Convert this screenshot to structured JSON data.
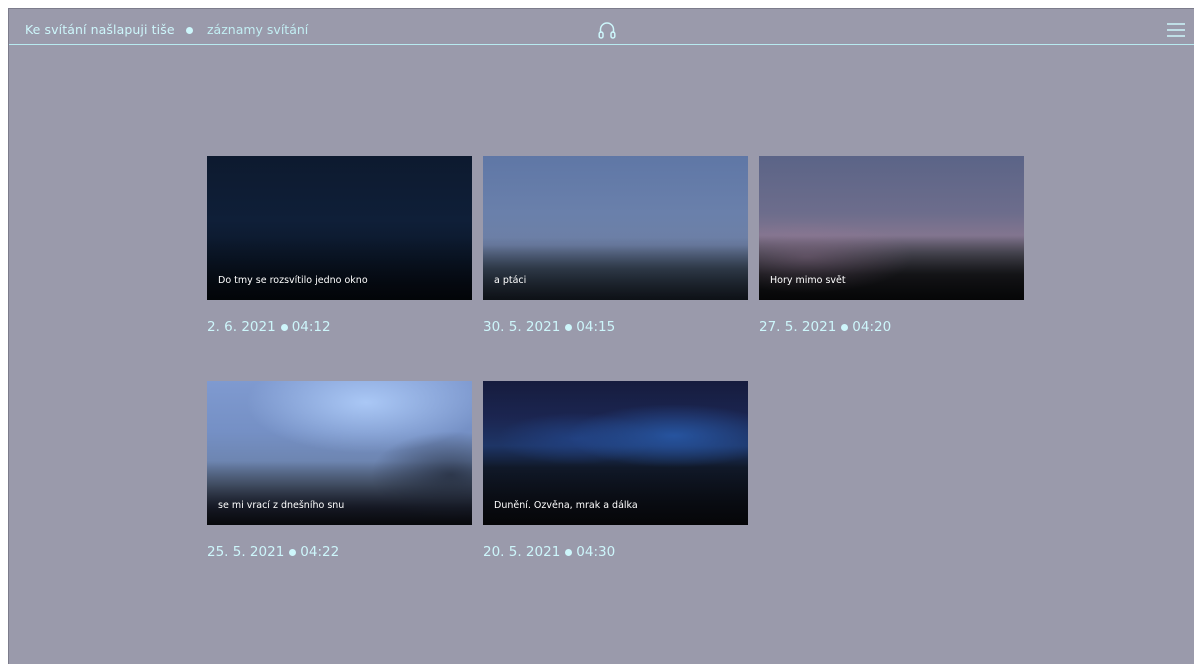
{
  "header": {
    "site_title": "Ke svítání našlapuji tiše",
    "section_title": "záznamy svítání",
    "audio_icon": "headphones-icon",
    "menu_icon": "hamburger-menu-icon"
  },
  "colors": {
    "background": "#9a9aab",
    "accent": "#cdf6fb"
  },
  "recordings": [
    {
      "caption": "Do tmy se rozsvítilo jedno okno",
      "date": "2. 6. 2021",
      "time": "04:12"
    },
    {
      "caption": "a ptáci",
      "date": "30. 5. 2021",
      "time": "04:15"
    },
    {
      "caption": "Hory mimo svět",
      "date": "27. 5. 2021",
      "time": "04:20"
    },
    {
      "caption": "se mi vrací z dnešního snu",
      "date": "25. 5. 2021",
      "time": "04:22"
    },
    {
      "caption": "Dunění. Ozvěna, mrak a dálka",
      "date": "20. 5. 2021",
      "time": "04:30"
    }
  ]
}
